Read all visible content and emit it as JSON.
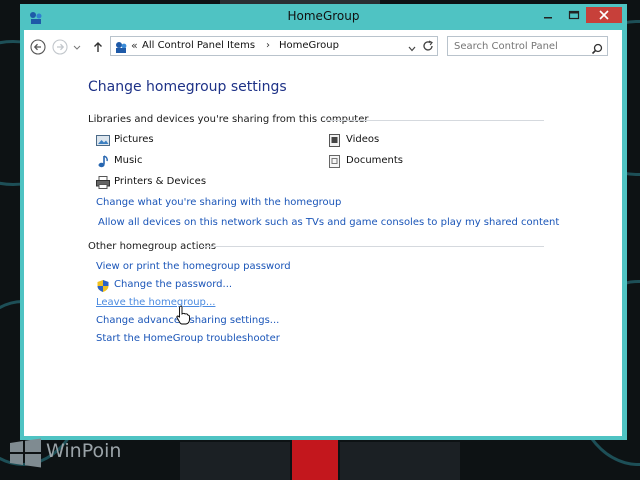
{
  "window": {
    "title": "HomeGroup",
    "accent": "#4fc3c3",
    "close_color": "#c7403a"
  },
  "navbar": {
    "back_icon": "back-arrow-icon",
    "forward_icon": "forward-arrow-icon",
    "up_icon": "up-arrow-icon",
    "breadcrumb_overflow": "«",
    "breadcrumb": [
      "All Control Panel Items",
      "HomeGroup"
    ],
    "breadcrumb_separator": "›",
    "search_placeholder": "Search Control Panel"
  },
  "main": {
    "page_title": "Change homegroup settings",
    "sharing_section_title": "Libraries and devices you're sharing from this computer",
    "libraries": [
      {
        "label": "Pictures",
        "icon": "pictures-icon"
      },
      {
        "label": "Videos",
        "icon": "videos-icon"
      },
      {
        "label": "Music",
        "icon": "music-icon"
      },
      {
        "label": "Documents",
        "icon": "documents-icon"
      },
      {
        "label": "Printers & Devices",
        "icon": "printer-icon"
      }
    ],
    "change_sharing_link": "Change what you're sharing with the homegroup",
    "allow_devices_link": "Allow all devices on this network such as TVs and game consoles to play my shared content",
    "other_section_title": "Other homegroup actions",
    "actions": [
      {
        "label": "View or print the homegroup password",
        "shield": false
      },
      {
        "label": "Change the password...",
        "shield": true
      },
      {
        "label": "Leave the homegroup...",
        "shield": false,
        "hovered": true
      },
      {
        "label": "Change advanced sharing settings...",
        "shield": false
      },
      {
        "label": "Start the HomeGroup troubleshooter",
        "shield": false
      }
    ],
    "link_color": "#1a55b8",
    "title_color": "#1e3287"
  },
  "watermark": {
    "text": "WinPoin"
  }
}
